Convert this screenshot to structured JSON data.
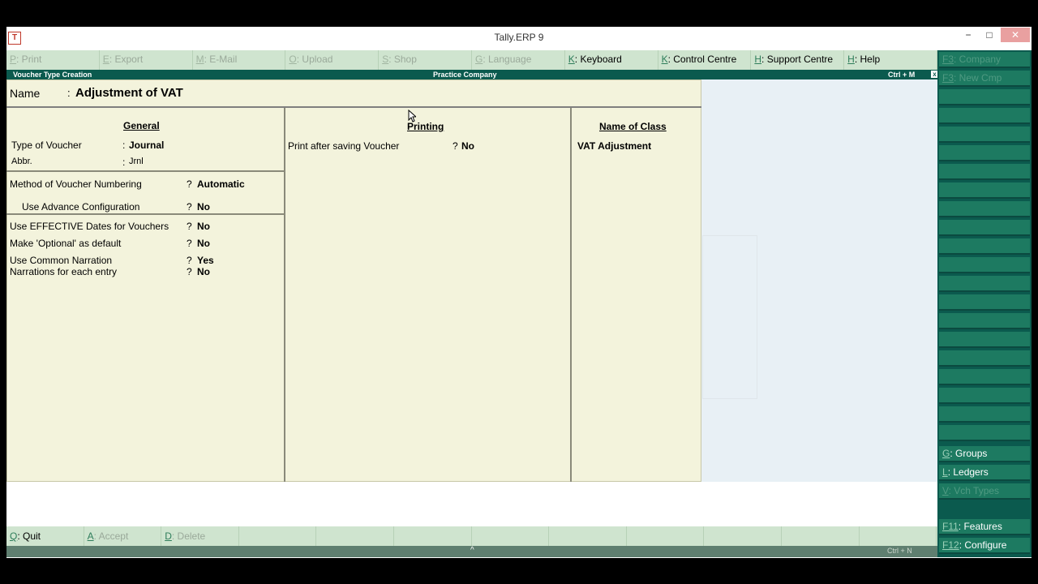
{
  "window": {
    "title": "Tally.ERP 9",
    "minimize_glyph": "−",
    "maximize_glyph": "□",
    "close_glyph": "✕",
    "app_icon": "tally-app-icon"
  },
  "menubar": {
    "items": [
      {
        "key": "P",
        "rest": ": Print",
        "enabled": false
      },
      {
        "key": "E",
        "rest": ": Export",
        "enabled": false
      },
      {
        "key": "M",
        "rest": ": E-Mail",
        "enabled": false
      },
      {
        "key": "O",
        "rest": ": Upload",
        "enabled": false
      },
      {
        "key": "S",
        "rest": ": Shop",
        "enabled": false
      },
      {
        "key": "G",
        "rest": ": Language",
        "enabled": false
      },
      {
        "key": "K",
        "rest": ": Keyboard",
        "enabled": true
      },
      {
        "key": "K",
        "rest": ": Control Centre",
        "enabled": true
      },
      {
        "key": "H",
        "rest": ": Support Centre",
        "enabled": true
      },
      {
        "key": "H",
        "rest": ": Help",
        "enabled": true
      }
    ]
  },
  "infobar": {
    "screen": "Voucher Type Creation",
    "company": "Practice Company",
    "shortcut": "Ctrl + M",
    "close_glyph": "x"
  },
  "form": {
    "name_label": "Name",
    "name_colon": ":",
    "name_value": "Adjustment of VAT",
    "general": {
      "heading": "General",
      "type_label": "Type of Voucher",
      "type_sep": ":",
      "type_value": "Journal",
      "abbr_label": "Abbr.",
      "abbr_sep": ":",
      "abbr_value": "Jrnl",
      "numbering_label": "Method of Voucher Numbering",
      "numbering_q": "?",
      "numbering_value": "Automatic",
      "advance_label": "Use Advance Configuration",
      "advance_q": "?",
      "advance_value": "No",
      "effective_label": "Use EFFECTIVE Dates for Vouchers",
      "effective_q": "?",
      "effective_value": "No",
      "optional_label": "Make 'Optional' as default",
      "optional_q": "?",
      "optional_value": "No",
      "common_label": "Use Common Narration",
      "common_q": "?",
      "common_value": "Yes",
      "each_label": "Narrations for each entry",
      "each_q": "?",
      "each_value": "No"
    },
    "printing": {
      "heading": "Printing",
      "print_label": "Print after saving Voucher",
      "print_q": "?",
      "print_value": "No"
    },
    "class": {
      "heading": "Name of Class",
      "value": "VAT Adjustment"
    }
  },
  "buttonbar": {
    "items": [
      {
        "key": "Q",
        "rest": ": Quit",
        "enabled": true
      },
      {
        "key": "A",
        "rest": ": Accept",
        "enabled": false
      },
      {
        "key": "D",
        "rest": ": Delete",
        "enabled": false
      },
      {
        "key": "",
        "rest": "",
        "enabled": false
      },
      {
        "key": "",
        "rest": "",
        "enabled": false
      },
      {
        "key": "",
        "rest": "",
        "enabled": false
      },
      {
        "key": "",
        "rest": "",
        "enabled": false
      },
      {
        "key": "",
        "rest": "",
        "enabled": false
      },
      {
        "key": "",
        "rest": "",
        "enabled": false
      },
      {
        "key": "",
        "rest": "",
        "enabled": false
      },
      {
        "key": "",
        "rest": "",
        "enabled": false
      },
      {
        "key": "",
        "rest": "",
        "enabled": false
      }
    ]
  },
  "statusbar": {
    "caret": "^",
    "shortcut": "Ctrl + N"
  },
  "rightpanel": {
    "top_items": [
      {
        "key": "F3",
        "rest": ": Company",
        "enabled": false
      },
      {
        "key": "F3",
        "rest": ": New Cmp",
        "enabled": false
      }
    ],
    "bottom_items": [
      {
        "key": "G",
        "rest": ": Groups",
        "enabled": true
      },
      {
        "key": "L",
        "rest": ": Ledgers",
        "enabled": true
      },
      {
        "key": "V",
        "rest": ": Vch Types",
        "enabled": false
      }
    ],
    "footer_items": [
      {
        "key": "F11",
        "rest": ": Features",
        "enabled": true
      },
      {
        "key": "F12",
        "rest": ": Configure",
        "enabled": true
      }
    ]
  }
}
